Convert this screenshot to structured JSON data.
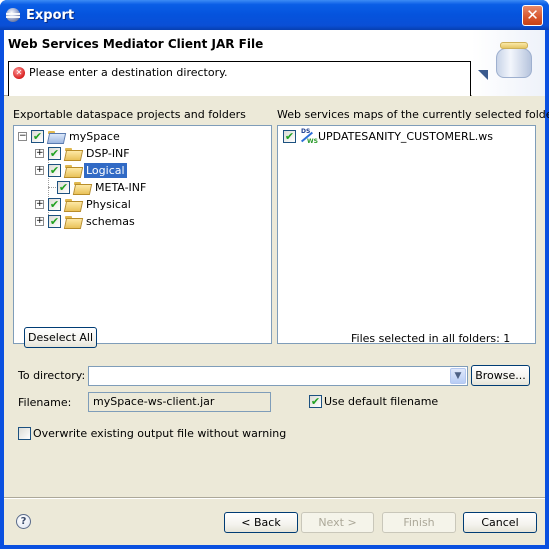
{
  "window": {
    "title": "Export",
    "close_icon": "close-icon"
  },
  "header": {
    "title": "Web Services Mediator Client JAR File",
    "message": "Please enter a destination directory.",
    "message_icon": "error-icon",
    "banner_icon": "jar-icon"
  },
  "left_panel": {
    "label": "Exportable dataspace projects and folders",
    "tree": [
      {
        "label": "mySpace",
        "level": 0,
        "expanded": true,
        "checked": true,
        "selected": false
      },
      {
        "label": "DSP-INF",
        "level": 1,
        "expandable": true,
        "checked": true,
        "selected": false
      },
      {
        "label": "Logical",
        "level": 1,
        "expandable": true,
        "checked": true,
        "selected": true
      },
      {
        "label": "META-INF",
        "level": 1,
        "expandable": false,
        "checked": true,
        "selected": false
      },
      {
        "label": "Physical",
        "level": 1,
        "expandable": true,
        "checked": true,
        "selected": false
      },
      {
        "label": "schemas",
        "level": 1,
        "expandable": true,
        "checked": true,
        "selected": false
      }
    ]
  },
  "right_panel": {
    "label": "Web services maps of the currently selected folder",
    "items": [
      {
        "label": "UPDATESANITY_CUSTOMERL.ws",
        "checked": true,
        "icon": "ds-ws-map-icon"
      }
    ]
  },
  "deselect_all_label": "Deselect All",
  "files_selected_text": "Files selected in all folders: 1",
  "to_directory": {
    "label": "To directory:",
    "value": "",
    "browse_label": "Browse..."
  },
  "filename": {
    "label": "Filename:",
    "value": "mySpace-ws-client.jar"
  },
  "use_default_filename": {
    "label": "Use default filename",
    "checked": true
  },
  "overwrite": {
    "label": "Overwrite existing output file without warning",
    "checked": false
  },
  "footer": {
    "help_icon": "help-icon",
    "back_label": "< Back",
    "next_label": "Next >",
    "finish_label": "Finish",
    "cancel_label": "Cancel",
    "next_enabled": false,
    "finish_enabled": false
  }
}
